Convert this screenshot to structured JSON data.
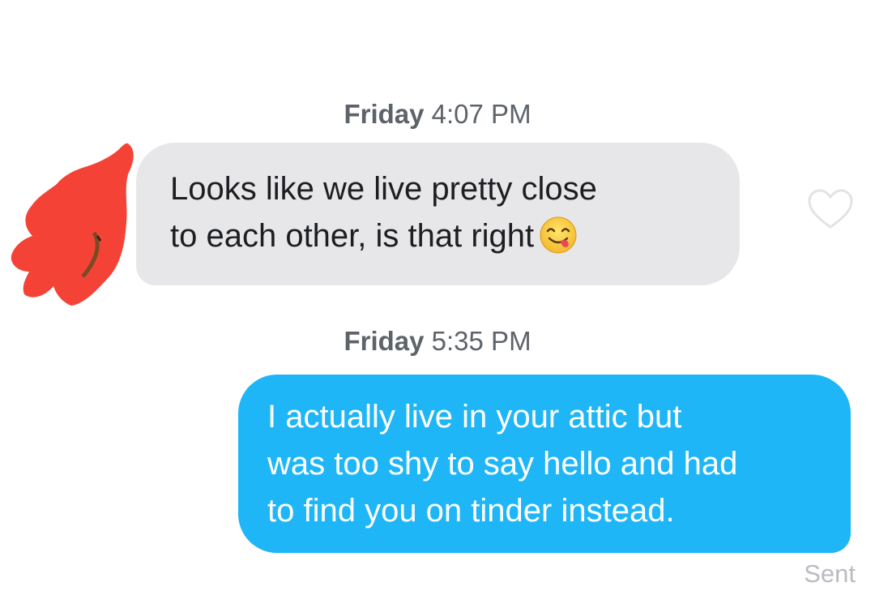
{
  "conversation": {
    "messages": [
      {
        "direction": "incoming",
        "timestamp_day": "Friday",
        "timestamp_time": "4:07 PM",
        "lines": [
          "Looks like we live pretty close",
          "to each other, is that right"
        ],
        "trailing_emoji": "face-savoring-food-emoji",
        "liked": false
      },
      {
        "direction": "outgoing",
        "timestamp_day": "Friday",
        "timestamp_time": "5:35 PM",
        "lines": [
          "I actually live in your attic but",
          "was too shy to say hello and had",
          "to find you on tinder instead."
        ],
        "status": "Sent"
      }
    ]
  },
  "colors": {
    "incoming_bubble": "#e7e7e9",
    "outgoing_bubble": "#1fb6f7",
    "avatar_redaction": "#f44336"
  },
  "icons": {
    "like": "heart-outline-icon",
    "avatar": "redacted-avatar"
  }
}
